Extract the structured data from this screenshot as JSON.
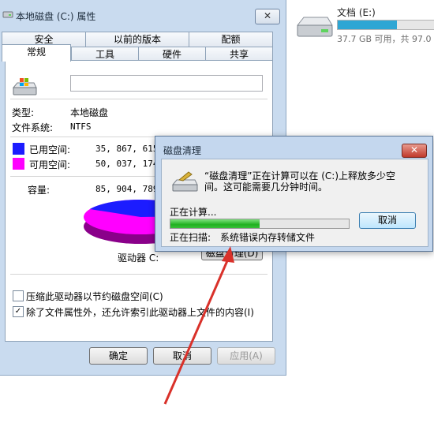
{
  "explorer": {
    "drive_name": "文档 (E:)",
    "drive_free_text": "37.7 GB 可用，共 97.0",
    "drive_used_fraction": 0.61,
    "drive_bar_color": "#2ea6d4"
  },
  "props": {
    "title": "本地磁盘 (C:) 属性",
    "close_label": "✕",
    "tabs_row1": [
      "安全",
      "以前的版本",
      "配额"
    ],
    "tabs_row2": [
      "常规",
      "工具",
      "硬件",
      "共享"
    ],
    "active_tab": "常规",
    "name_value": "",
    "type_label": "类型:",
    "type_value": "本地磁盘",
    "fs_label": "文件系统:",
    "fs_value": "NTFS",
    "used_label": "已用空间:",
    "used_value": "35, 867, 615, 23",
    "free_label": "可用空间:",
    "free_value": "50, 037, 174, 27",
    "capacity_label": "容量:",
    "capacity_value": "85, 904, 789, 50",
    "used_color": "#1c1cff",
    "free_color": "#ff00ff",
    "drive_label": "驱动器 C:",
    "cleanup_button": "磁盘清理(D)",
    "compress_label": "压缩此驱动器以节约磁盘空间(C)",
    "compress_checked": false,
    "index_label": "除了文件属性外，还允许索引此驱动器上文件的内容(I)",
    "index_checked": true,
    "ok_label": "确定",
    "cancel_label": "取消",
    "apply_label": "应用(A)"
  },
  "cleanup": {
    "title": "磁盘清理",
    "close_label": "✕",
    "message_line1": "“磁盘清理”正在计算可以在 (C:)上释放多少空",
    "message_line2": "间。这可能需要几分钟时间。",
    "status_label": "正在计算...",
    "progress_fraction": 0.5,
    "cancel_label": "取消",
    "scanning_label": "正在扫描:",
    "scanning_value": "系统错误内存转储文件"
  },
  "overlay": {
    "arrow_color": "#d9312a"
  }
}
